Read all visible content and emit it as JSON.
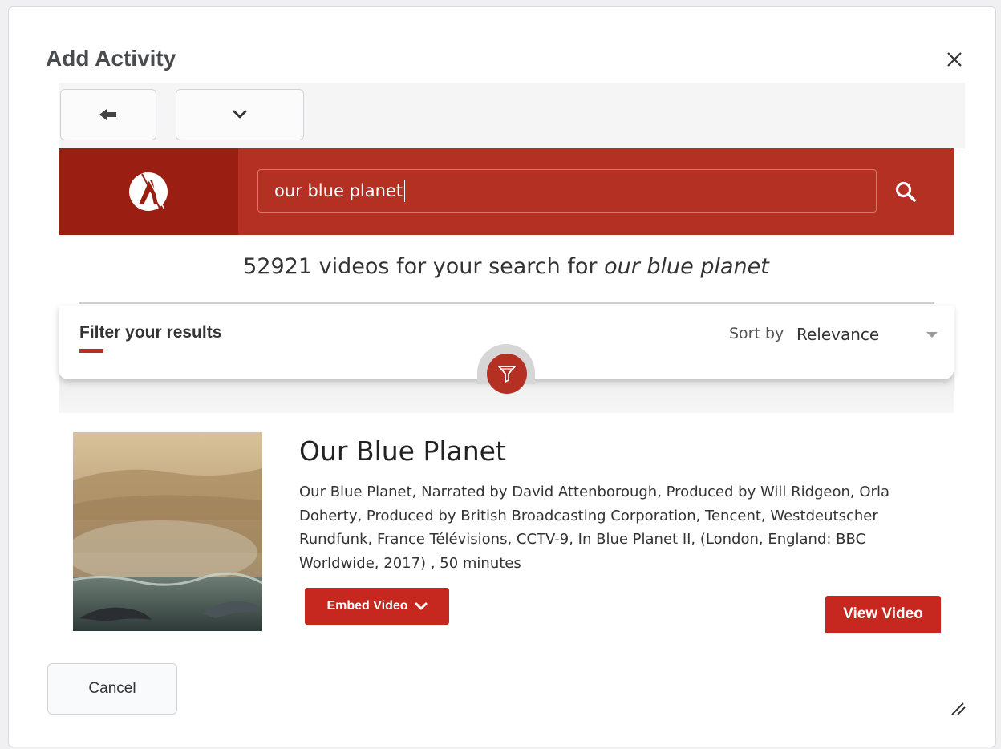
{
  "dialog": {
    "title": "Add Activity",
    "close_icon": "close-icon"
  },
  "toolbar": {
    "back_icon": "arrow-left-icon",
    "more_icon": "chevron-down-icon"
  },
  "header": {
    "logo_icon": "publisher-logo-icon",
    "search": {
      "value": "our blue planet",
      "icon": "search-icon"
    },
    "colors": {
      "brand": "#b33022",
      "brand_dark": "#9a1e12"
    }
  },
  "results": {
    "count": "52921",
    "count_text_prefix": "videos for your search for",
    "query": "our blue planet"
  },
  "filter": {
    "title": "Filter your results",
    "sort_label": "Sort by",
    "sort_value": "Relevance",
    "filter_icon": "funnel-icon"
  },
  "result_item": {
    "title": "Our Blue Planet",
    "description": "Our Blue Planet, Narrated by David Attenborough, Produced by Will Ridgeon, Orla Doherty, Produced by British Broadcasting Corporation, Tencent, Westdeutscher Rundfunk, France Télévisions, CCTV-9, In Blue Planet II, (London, England: BBC Worldwide, 2017) , 50 minutes",
    "embed_label": "Embed Video",
    "view_label": "View Video",
    "thumbnail": "dolphins-leaping-thumbnail"
  },
  "footer": {
    "cancel_label": "Cancel"
  }
}
